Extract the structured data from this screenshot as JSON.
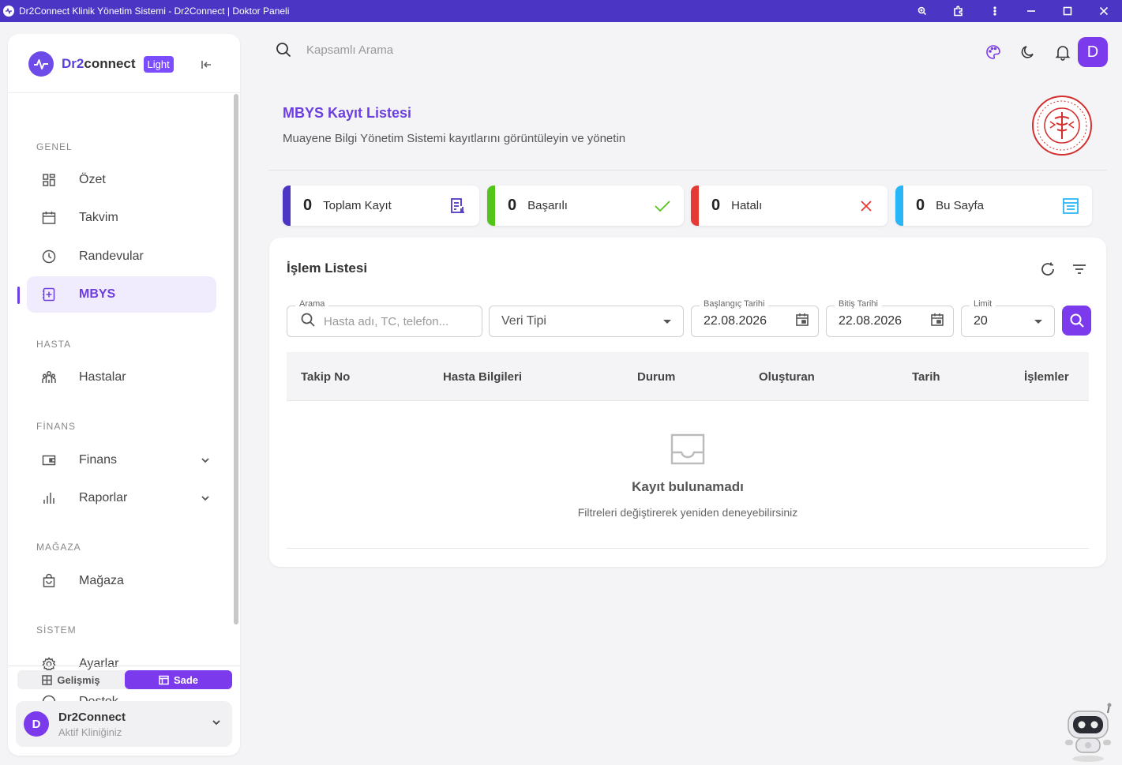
{
  "window": {
    "title": "Dr2Connect Klinik Yönetim Sistemi - Dr2Connect | Doktor Paneli"
  },
  "brand": {
    "name_a": "Dr2",
    "name_b": "connect",
    "badge": "Light"
  },
  "sidebar": {
    "sections": {
      "genel": "GENEL",
      "hasta": "HASTA",
      "finans": "FİNANS",
      "magaza": "MAĞAZA",
      "sistem": "SİSTEM"
    },
    "items": [
      {
        "label": "Özet",
        "icon": "dashboard-icon"
      },
      {
        "label": "Takvim",
        "icon": "calendar-icon"
      },
      {
        "label": "Randevular",
        "icon": "clock-icon"
      },
      {
        "label": "MBYS",
        "icon": "medical-file-icon",
        "active": true
      },
      {
        "label": "Hastalar",
        "icon": "patients-icon"
      },
      {
        "label": "Finans",
        "icon": "wallet-icon"
      },
      {
        "label": "Raporlar",
        "icon": "bar-chart-icon"
      },
      {
        "label": "Mağaza",
        "icon": "shopping-bag-icon"
      },
      {
        "label": "Ayarlar",
        "icon": "gear-icon"
      },
      {
        "label": "Destek",
        "icon": "help-icon"
      }
    ],
    "mode_toggle": {
      "advanced": "Gelişmiş",
      "simple": "Sade",
      "selected": "Sade"
    },
    "clinic": {
      "avatar": "D",
      "name": "Dr2Connect",
      "subtitle": "Aktif Kliniğiniz"
    }
  },
  "topbar": {
    "search_placeholder": "Kapsamlı Arama",
    "user_initial": "D"
  },
  "page": {
    "title": "MBYS Kayıt Listesi",
    "subtitle": "Muayene Bilgi Yönetim Sistemi kayıtlarını görüntüleyin ve yönetin"
  },
  "stats": [
    {
      "value": "0",
      "label": "Toplam Kayıt",
      "color": "#4b35c4",
      "icon": "document-list-icon"
    },
    {
      "value": "0",
      "label": "Başarılı",
      "color": "#52c41a",
      "icon": "check-icon"
    },
    {
      "value": "0",
      "label": "Hatalı",
      "color": "#e53935",
      "icon": "x-icon"
    },
    {
      "value": "0",
      "label": "Bu Sayfa",
      "color": "#29b6f6",
      "icon": "page-icon"
    }
  ],
  "panel": {
    "title": "İşlem Listesi",
    "filters": {
      "search_label": "Arama",
      "search_placeholder": "Hasta adı, TC, telefon...",
      "type_value": "Veri Tipi",
      "start_label": "Başlangıç Tarihi",
      "start_value": "22.08.2026",
      "end_label": "Bitiş Tarihi",
      "end_value": "22.08.2026",
      "limit_label": "Limit",
      "limit_value": "20"
    },
    "columns": [
      "Takip No",
      "Hasta Bilgileri",
      "Durum",
      "Oluşturan",
      "Tarih",
      "İşlemler"
    ],
    "empty_title": "Kayıt bulunamadı",
    "empty_subtitle": "Filtreleri değiştirerek yeniden deneyebilirsiniz"
  },
  "colors": {
    "accent": "#7c3aed",
    "titlebar": "#4b35c4"
  }
}
